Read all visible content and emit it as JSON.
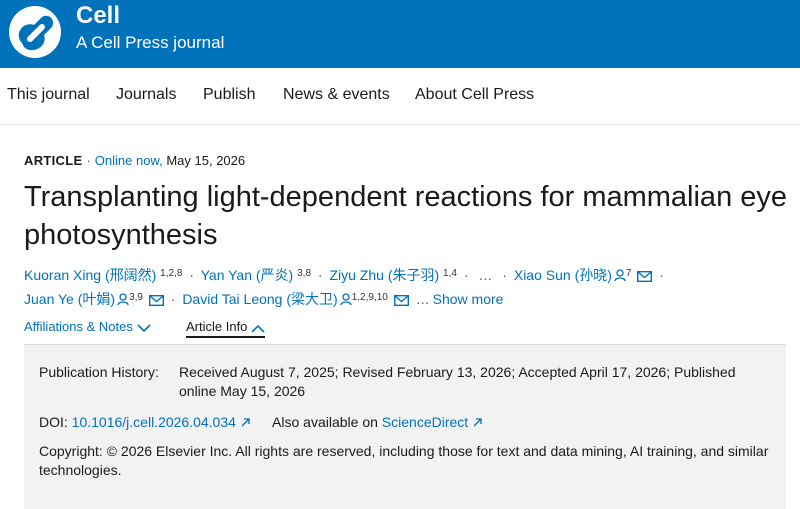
{
  "brand": {
    "name": "Cell",
    "tagline": "A Cell Press journal",
    "accent_color": "#0072bc"
  },
  "nav": {
    "items": [
      {
        "label": "This journal"
      },
      {
        "label": "Journals"
      },
      {
        "label": "Publish"
      },
      {
        "label": "News & events"
      },
      {
        "label": "About Cell Press"
      }
    ]
  },
  "article": {
    "type": "ARTICLE",
    "online_label": "Online now,",
    "date": "May 15, 2026",
    "title": "Transplanting light-dependent reactions for mammalian eye photosynthesis",
    "authors": [
      {
        "name": "Kuoran Xing (邢阔然)",
        "affil": "1,2,8"
      },
      {
        "name": "Yan Yan (严炎)",
        "affil": "3,8"
      },
      {
        "name": "Ziyu Zhu (朱子羽)",
        "affil": "1,4"
      },
      {
        "name": "Xiao Sun (孙晓)",
        "affil": "7"
      },
      {
        "name": "Juan Ye (叶娟)",
        "affil": "3,9"
      },
      {
        "name": "David Tai Leong (梁大卫)",
        "affil": "1,2,9,10"
      }
    ],
    "ellipsis": "…",
    "show_more": "Show more"
  },
  "tabs": [
    {
      "label": "Affiliations & Notes",
      "icon": "chevron-down-icon"
    },
    {
      "label": "Article Info",
      "icon": "chevron-up-icon",
      "active": true
    }
  ],
  "article_info": {
    "history_label": "Publication History:",
    "history_value": "Received August 7, 2025; Revised February 13, 2026; Accepted April 17, 2026; Published online May 15, 2026",
    "doi_label": "DOI:",
    "doi_value": "10.1016/j.cell.2026.04.034",
    "also_label": "Also available on",
    "also_link": "ScienceDirect",
    "copyright": "Copyright: © 2026 Elsevier Inc. All rights are reserved, including those for text and data mining, AI training, and similar technologies."
  }
}
